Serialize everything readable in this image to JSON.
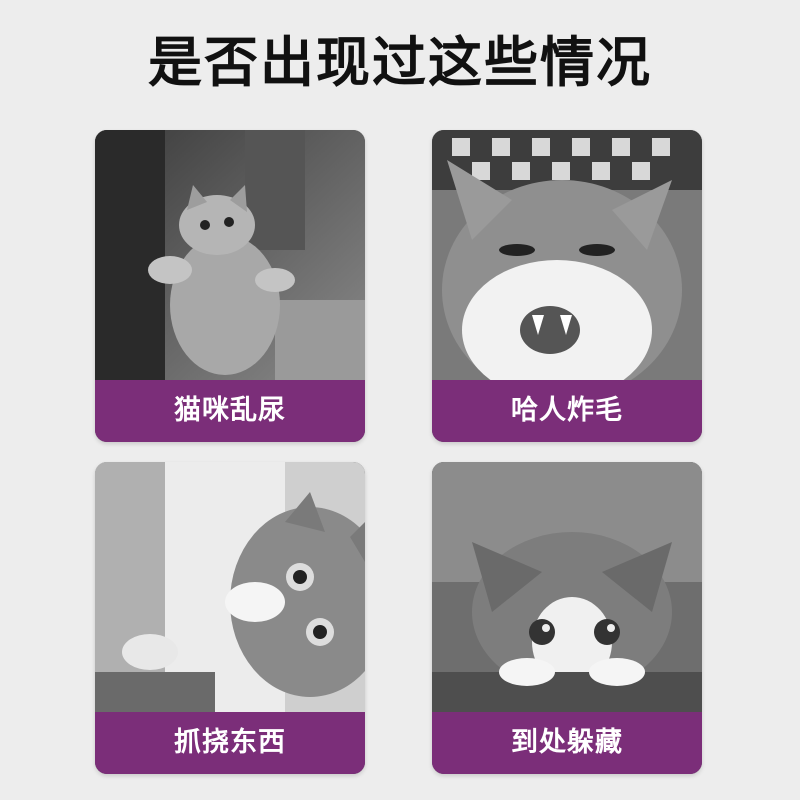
{
  "header": {
    "title": "是否出现过这些情况"
  },
  "colors": {
    "label_bg": "#7b2e79",
    "page_bg": "#ededed"
  },
  "cards": [
    {
      "label": "猫咪乱尿",
      "photo": "cat-standing-photo"
    },
    {
      "label": "哈人炸毛",
      "photo": "cat-hissing-photo"
    },
    {
      "label": "抓挠东西",
      "photo": "cat-scratching-photo"
    },
    {
      "label": "到处躲藏",
      "photo": "cat-hiding-photo"
    }
  ]
}
